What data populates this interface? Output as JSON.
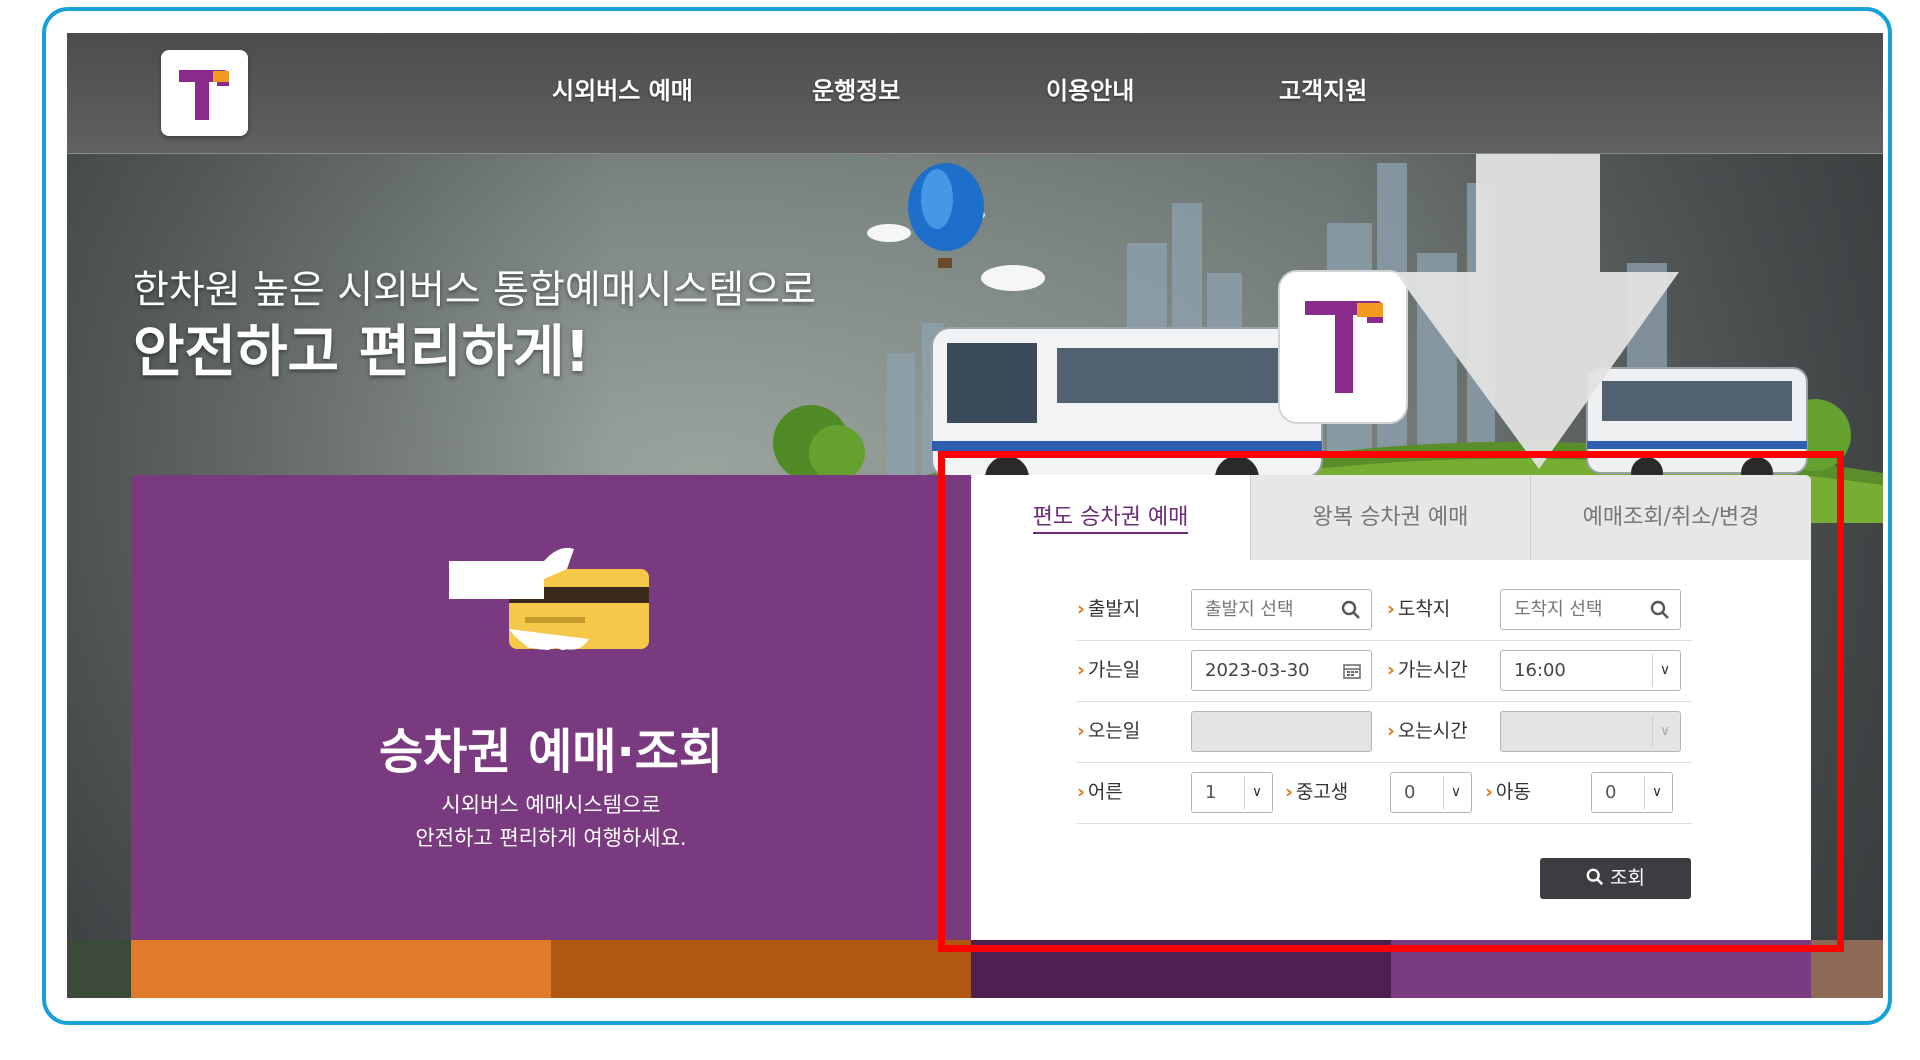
{
  "colors": {
    "frame_border": "#1aa0d8",
    "brand_purple": "#7a3a80",
    "logo_orange": "#f39a21",
    "highlight_red": "#ff0000",
    "search_button": "#3b3d40"
  },
  "header": {
    "logo_icon": "t-money-logo-icon",
    "nav": [
      "시외버스 예매",
      "운행정보",
      "이용안내",
      "고객지원"
    ]
  },
  "hero": {
    "subtitle": "한차원 높은 시외버스 통합예매시스템으로",
    "title": "안전하고 편리하게!"
  },
  "card": {
    "icon": "hand-card-icon",
    "title": "승차권 예매·조회",
    "desc_line1": "시외버스 예매시스템으로",
    "desc_line2": "안전하고 편리하게 여행하세요."
  },
  "booking": {
    "tabs": [
      {
        "label": "편도 승차권 예매",
        "active": true
      },
      {
        "label": "왕복 승차권 예매",
        "active": false
      },
      {
        "label": "예매조회/취소/변경",
        "active": false
      }
    ],
    "departure": {
      "label": "출발지",
      "placeholder": "출발지 선택",
      "icon": "search-icon"
    },
    "arrival": {
      "label": "도착지",
      "placeholder": "도착지 선택",
      "icon": "search-icon"
    },
    "go_date": {
      "label": "가는일",
      "value": "2023-03-30",
      "icon": "calendar-icon"
    },
    "go_time": {
      "label": "가는시간",
      "value": "16:00"
    },
    "return_date": {
      "label": "오는일",
      "value": ""
    },
    "return_time": {
      "label": "오는시간",
      "value": ""
    },
    "adult": {
      "label": "어른",
      "value": "1"
    },
    "student": {
      "label": "중고생",
      "value": "0"
    },
    "child": {
      "label": "아동",
      "value": "0"
    },
    "search_button": "조회"
  }
}
